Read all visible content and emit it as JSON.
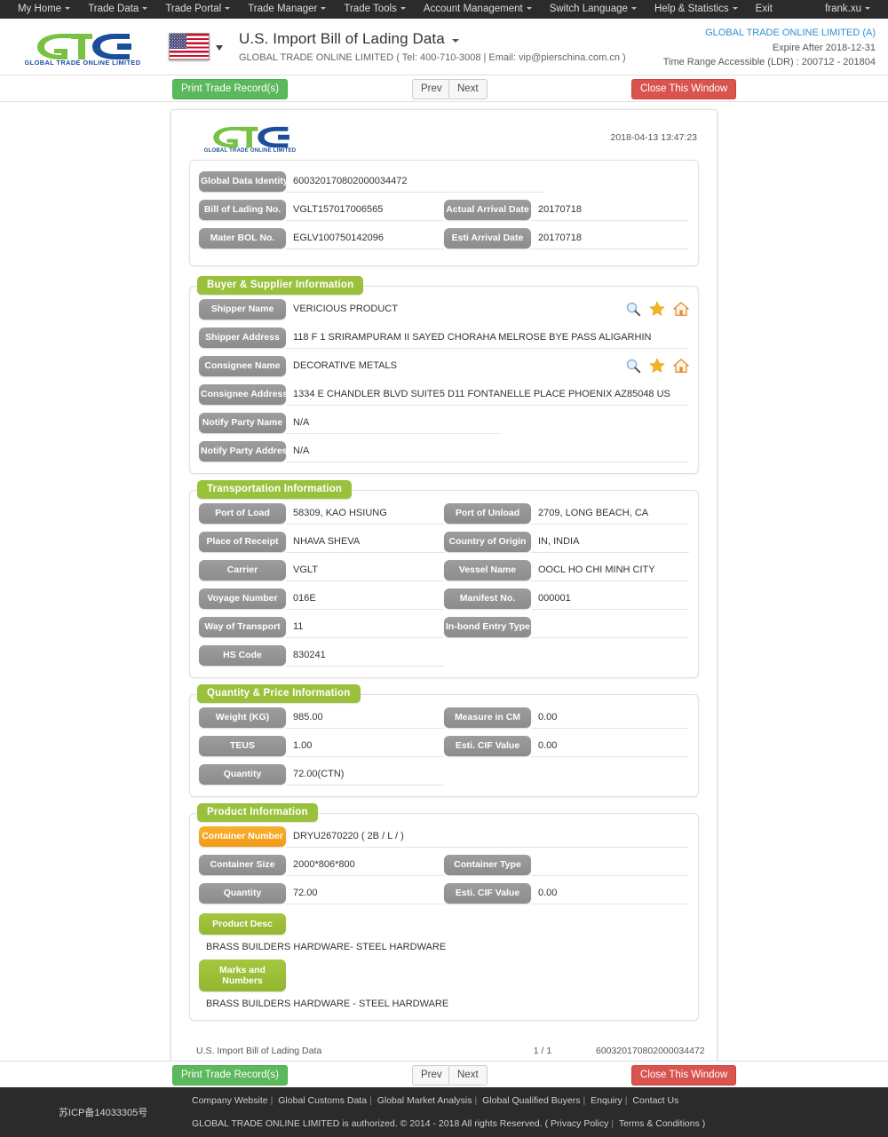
{
  "topnav": {
    "items": [
      {
        "label": "My Home",
        "caret": true
      },
      {
        "label": "Trade Data",
        "caret": true
      },
      {
        "label": "Trade Portal",
        "caret": true
      },
      {
        "label": "Trade Manager",
        "caret": true
      },
      {
        "label": "Trade Tools",
        "caret": true
      },
      {
        "label": "Account Management",
        "caret": true
      },
      {
        "label": "Switch Language",
        "caret": true
      },
      {
        "label": "Help & Statistics",
        "caret": true
      },
      {
        "label": "Exit",
        "caret": false
      }
    ],
    "user": "frank.xu"
  },
  "brand": {
    "logo_text": "GLOBAL TRADE ONLINE LIMITED",
    "flag": "us-flag-icon",
    "page_title": "U.S. Import Bill of Lading Data",
    "sub_title": "GLOBAL TRADE ONLINE LIMITED ( Tel: 400-710-3008 | Email: vip@pierschina.com.cn )",
    "account_name": "GLOBAL TRADE ONLINE LIMITED (A)",
    "expire": "Expire After 2018-12-31",
    "time_range": "Time Range Accessible (LDR) : 200712 - 201804",
    "accent_blue": "#2f8fd0"
  },
  "toolbar": {
    "print_label": "Print Trade Record(s)",
    "prev_label": "Prev",
    "next_label": "Next",
    "close_label": "Close This Window",
    "green": "#5cb85c",
    "red": "#d9534f"
  },
  "sheet": {
    "timestamp": "2018-04-13 13:47:23",
    "identity": {
      "global_data_identity_label": "Global Data Identity",
      "global_data_identity_value": "600320170802000034472",
      "bill_of_lading_label": "Bill of Lading No.",
      "bill_of_lading_value": "VGLT157017006565",
      "actual_arrival_label": "Actual Arrival Date",
      "actual_arrival_value": "20170718",
      "mater_bol_label": "Mater BOL No.",
      "mater_bol_value": "EGLV100750142096",
      "esti_arrival_label": "Esti Arrival Date",
      "esti_arrival_value": "20170718"
    },
    "buyer_supplier": {
      "legend": "Buyer & Supplier Information",
      "shipper_name_label": "Shipper Name",
      "shipper_name_value": "VERICIOUS PRODUCT",
      "shipper_address_label": "Shipper Address",
      "shipper_address_value": "118 F 1 SRIRAMPURAM II SAYED CHORAHA MELROSE BYE PASS ALIGARHIN",
      "consignee_name_label": "Consignee Name",
      "consignee_name_value": "DECORATIVE METALS",
      "consignee_address_label": "Consignee Address",
      "consignee_address_value": "1334 E CHANDLER BLVD SUITE5 D11 FONTANELLE PLACE PHOENIX AZ85048 US",
      "notify_party_name_label": "Notify Party Name",
      "notify_party_name_value": "N/A",
      "notify_party_address_label": "Notify Party Address",
      "notify_party_address_value": "N/A"
    },
    "transportation": {
      "legend": "Transportation Information",
      "port_of_load_label": "Port of Load",
      "port_of_load_value": "58309, KAO HSIUNG",
      "port_of_unload_label": "Port of Unload",
      "port_of_unload_value": "2709, LONG BEACH, CA",
      "place_of_receipt_label": "Place of Receipt",
      "place_of_receipt_value": "NHAVA SHEVA",
      "country_of_origin_label": "Country of Origin",
      "country_of_origin_value": "IN, INDIA",
      "carrier_label": "Carrier",
      "carrier_value": "VGLT",
      "vessel_name_label": "Vessel Name",
      "vessel_name_value": "OOCL HO CHI MINH CITY",
      "voyage_number_label": "Voyage Number",
      "voyage_number_value": "016E",
      "manifest_no_label": "Manifest No.",
      "manifest_no_value": "000001",
      "way_of_transport_label": "Way of Transport",
      "way_of_transport_value": "11",
      "inbond_entry_type_label": "In-bond Entry Type",
      "inbond_entry_type_value": "",
      "hs_code_label": "HS Code",
      "hs_code_value": "830241"
    },
    "quantity_price": {
      "legend": "Quantity & Price Information",
      "weight_label": "Weight (KG)",
      "weight_value": "985.00",
      "measure_label": "Measure in CM",
      "measure_value": "0.00",
      "teus_label": "TEUS",
      "teus_value": "1.00",
      "cif_label": "Esti. CIF Value",
      "cif_value": "0.00",
      "quantity_label": "Quantity",
      "quantity_value": "72.00(CTN)"
    },
    "product": {
      "legend": "Product Information",
      "container_number_label": "Container Number",
      "container_number_value": "DRYU2670220 ( 2B / L /  )",
      "container_size_label": "Container Size",
      "container_size_value": "2000*806*800",
      "container_type_label": "Container Type",
      "container_type_value": "",
      "quantity_label": "Quantity",
      "quantity_value": "72.00",
      "cif_label": "Esti. CIF Value",
      "cif_value": "0.00",
      "product_desc_label": "Product Desc",
      "product_desc_value": "BRASS BUILDERS HARDWARE- STEEL HARDWARE",
      "marks_label": "Marks and Numbers",
      "marks_value": "BRASS BUILDERS HARDWARE - STEEL HARDWARE"
    },
    "footer": {
      "doc_name": "U.S. Import Bill of Lading Data",
      "page_no": "1 / 1",
      "doc_id": "600320170802000034472"
    },
    "icons": {
      "search": "search-icon",
      "star": "star-icon",
      "home": "home-icon"
    },
    "colors": {
      "legend_green": "#9ac13c",
      "label_gray": "#949494",
      "label_orange": "#f4a01b"
    }
  },
  "sitefooter": {
    "icp": "苏ICP备14033305号",
    "links": [
      "Company Website",
      "Global Customs Data",
      "Global Market Analysis",
      "Global Qualified Buyers",
      "Enquiry",
      "Contact Us"
    ],
    "copyright": "GLOBAL TRADE ONLINE LIMITED is authorized. © 2014 - 2018 All rights Reserved.  (",
    "privacy": "Privacy Policy",
    "terms": "Terms & Conditions",
    "close_paren": ")"
  }
}
